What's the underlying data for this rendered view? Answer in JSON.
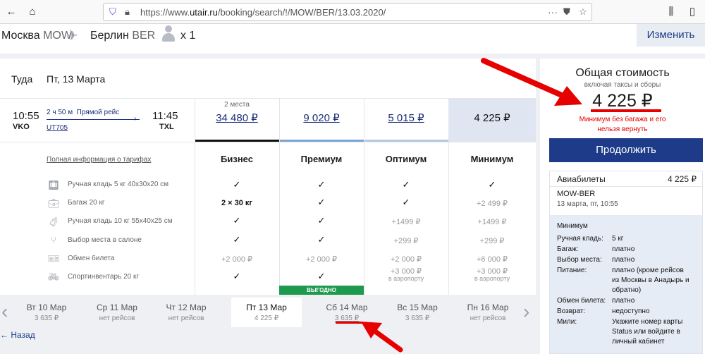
{
  "browser": {
    "url_prefix": "https://www.",
    "url_domain": "utair.ru",
    "url_path": "/booking/search/!/MOW/BER/13.03.2020/"
  },
  "route": {
    "from_city": "Москва",
    "from_code": "MOW",
    "to_city": "Берлин",
    "to_code": "BER",
    "passengers": "x 1",
    "change_label": "Изменить"
  },
  "flight": {
    "direction": "Туда",
    "date": "Пт, 13 Марта",
    "dep_time": "10:55",
    "dep_airport": "VKO",
    "arr_time": "11:45",
    "arr_airport": "TXL",
    "duration": "2 ч 50 м",
    "type": "Прямой рейс",
    "number": "UT705"
  },
  "fares": [
    {
      "name": "Бизнес",
      "price": "34 480 ₽",
      "note": "2 места"
    },
    {
      "name": "Премиум",
      "price": "9 020 ₽"
    },
    {
      "name": "Оптимум",
      "price": "5 015 ₽"
    },
    {
      "name": "Минимум",
      "price": "4 225 ₽"
    }
  ],
  "tariff_link": "Полная информация о тарифах",
  "features": [
    "Ручная кладь 5 кг 40x30x20 см",
    "Багаж 20 кг",
    "Ручная кладь 10 кг 55x40x25 см",
    "Выбор места в салоне",
    "Обмен билета",
    "Спортинвентарь 20 кг"
  ],
  "cells": {
    "bag_business": "2 × 30 кг",
    "min_bag": "+2 499 ₽",
    "opt_hand10": "+1499 ₽",
    "min_hand10": "+1499 ₽",
    "opt_seat": "+299 ₽",
    "min_seat": "+299 ₽",
    "bus_exch": "+2 000 ₽",
    "prem_exch": "+2 000 ₽",
    "opt_exch": "+2 000 ₽",
    "min_exch": "+6 000 ₽",
    "opt_sport": "+3 000 ₽",
    "opt_sport_sub": "в аэропорту",
    "min_sport": "+3 000 ₽",
    "min_sport_sub": "в аэропорту",
    "best_badge": "ВЫГОДНО"
  },
  "dates": [
    {
      "day": "Вт 10 Мар",
      "price": "3 635 ₽"
    },
    {
      "day": "Ср 11 Мар",
      "price": "нет рейсов"
    },
    {
      "day": "Чт 12 Мар",
      "price": "нет рейсов"
    },
    {
      "day": "Пт 13 Мар",
      "price": "4 225 ₽"
    },
    {
      "day": "Сб 14 Мар",
      "price": "3 635 ₽"
    },
    {
      "day": "Вс 15 Мар",
      "price": "3 635 ₽"
    },
    {
      "day": "Пн 16 Мар",
      "price": "нет рейсов"
    }
  ],
  "back_label": "← Назад",
  "sidebar": {
    "total_title": "Общая стоимость",
    "total_sub": "включая таксы и сборы",
    "total": "4 225 ₽",
    "warning_1": "Минимум без багажа и его",
    "warning_2": "нельзя вернуть",
    "continue_label": "Продолжить",
    "tickets_label": "Авиабилеты",
    "tickets_price": "4 225 ₽",
    "route": "MOW-BER",
    "route_date": "13 марта, пт, 10:55",
    "fare_name": "Минимум",
    "rows": [
      {
        "k": "Ручная кладь:",
        "v": "5 кг"
      },
      {
        "k": "Багаж:",
        "v": "платно"
      },
      {
        "k": "Выбор места:",
        "v": "платно"
      },
      {
        "k": "Питание:",
        "v": "платно (кроме рейсов"
      },
      {
        "k": "",
        "v": "из Москвы в Анадырь и"
      },
      {
        "k": "",
        "v": "обратно)"
      },
      {
        "k": "Обмен билета:",
        "v": "платно"
      },
      {
        "k": "Возврат:",
        "v": "недоступно"
      },
      {
        "k": "Мили:",
        "v": "Укажите номер карты"
      },
      {
        "k": "",
        "v": "Status или войдите в"
      },
      {
        "k": "",
        "v": "личный кабинет"
      }
    ]
  },
  "colors": {
    "brand": "#1d3b88",
    "accent_red": "#e60000",
    "badge_green": "#1e9a4e"
  }
}
